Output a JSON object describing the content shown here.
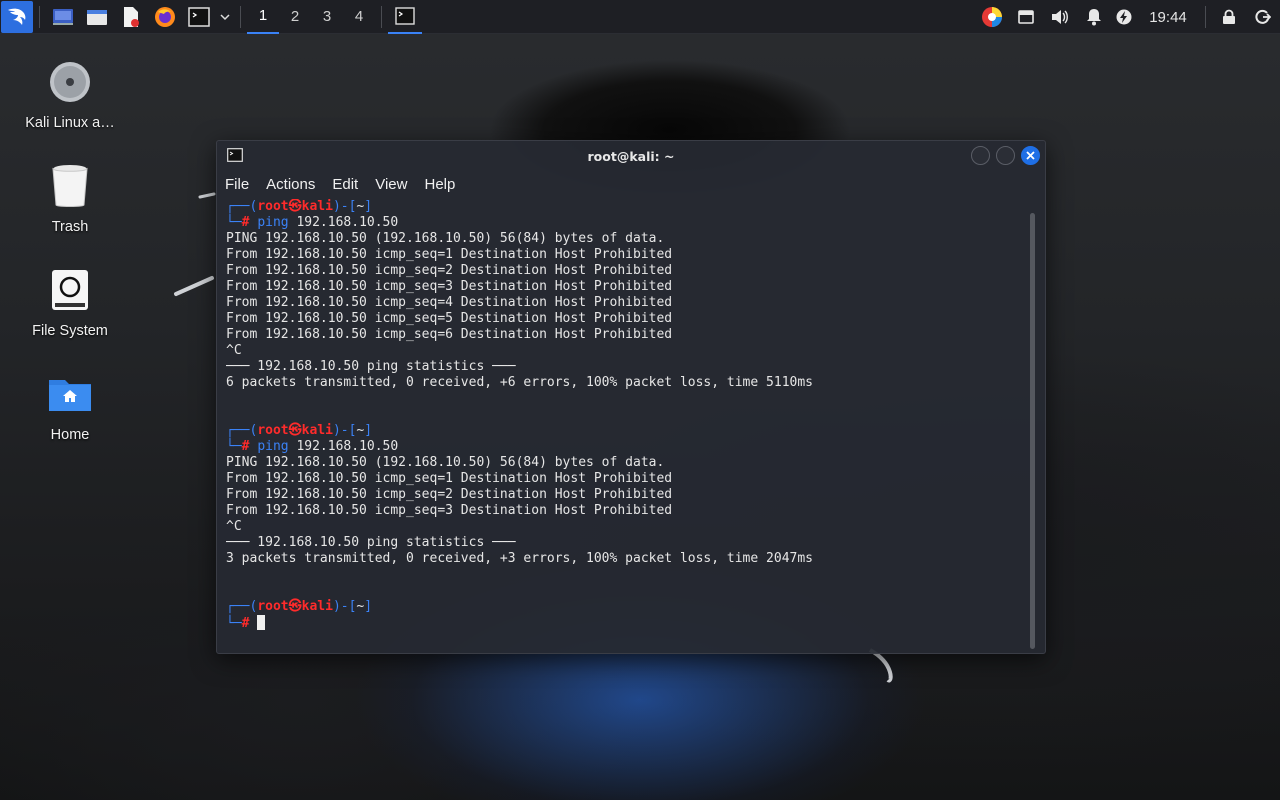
{
  "taskbar": {
    "workspaces": [
      "1",
      "2",
      "3",
      "4"
    ],
    "active_workspace": "1",
    "clock": "19:44",
    "launchers": [
      "display-icon",
      "file-manager-icon",
      "text-editor-icon",
      "firefox-icon",
      "terminal-icon"
    ]
  },
  "desktop": {
    "icons": [
      {
        "label": "Kali Linux a…",
        "icon": "disc-icon"
      },
      {
        "label": "Trash",
        "icon": "trash-icon"
      },
      {
        "label": "File System",
        "icon": "drive-icon"
      },
      {
        "label": "Home",
        "icon": "home-folder-icon"
      }
    ]
  },
  "window": {
    "title": "root@kali: ~",
    "menu": [
      "File",
      "Actions",
      "Edit",
      "View",
      "Help"
    ]
  },
  "terminal": {
    "prompt": {
      "corner_top": "┌──(",
      "user": "root㉿kali",
      "dir_open": ")-[",
      "dir": "~",
      "dir_close": "]",
      "corner_bottom": "└─",
      "hash": "#"
    },
    "sessions": [
      {
        "cmd": "ping",
        "arg": " 192.168.10.50",
        "output": [
          "PING 192.168.10.50 (192.168.10.50) 56(84) bytes of data.",
          "From 192.168.10.50 icmp_seq=1 Destination Host Prohibited",
          "From 192.168.10.50 icmp_seq=2 Destination Host Prohibited",
          "From 192.168.10.50 icmp_seq=3 Destination Host Prohibited",
          "From 192.168.10.50 icmp_seq=4 Destination Host Prohibited",
          "From 192.168.10.50 icmp_seq=5 Destination Host Prohibited",
          "From 192.168.10.50 icmp_seq=6 Destination Host Prohibited",
          "^C",
          "─── 192.168.10.50 ping statistics ───",
          "6 packets transmitted, 0 received, +6 errors, 100% packet loss, time 5110ms"
        ]
      },
      {
        "cmd": "ping",
        "arg": " 192.168.10.50",
        "output": [
          "PING 192.168.10.50 (192.168.10.50) 56(84) bytes of data.",
          "From 192.168.10.50 icmp_seq=1 Destination Host Prohibited",
          "From 192.168.10.50 icmp_seq=2 Destination Host Prohibited",
          "From 192.168.10.50 icmp_seq=3 Destination Host Prohibited",
          "^C",
          "─── 192.168.10.50 ping statistics ───",
          "3 packets transmitted, 0 received, +3 errors, 100% packet loss, time 2047ms"
        ]
      }
    ]
  }
}
